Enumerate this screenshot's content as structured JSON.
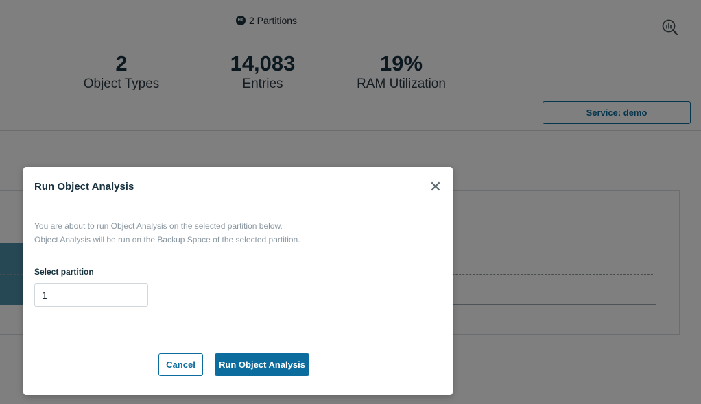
{
  "header": {
    "partitions_badge": "HA",
    "partitions_text": "2 Partitions",
    "analytics_icon": "analytics-search-icon"
  },
  "stats": [
    {
      "value": "2",
      "label": "Object Types"
    },
    {
      "value": "14,083",
      "label": "Entries"
    },
    {
      "value": "19%",
      "label": "RAM Utilization"
    }
  ],
  "service_button": "Service: demo",
  "modal": {
    "title": "Run Object Analysis",
    "close_icon": "close-icon",
    "description_line1": "You are about to run Object Analysis on the selected partition below.",
    "description_line2": "Object Analysis will be run on the Backup Space of the selected partition.",
    "field_label": "Select partition",
    "partition_value": "1",
    "cancel_label": "Cancel",
    "run_label": "Run Object Analysis"
  },
  "colors": {
    "accent": "#0d6c9e",
    "overlay": "rgba(0,0,0,0.5)",
    "title": "#17313f"
  }
}
